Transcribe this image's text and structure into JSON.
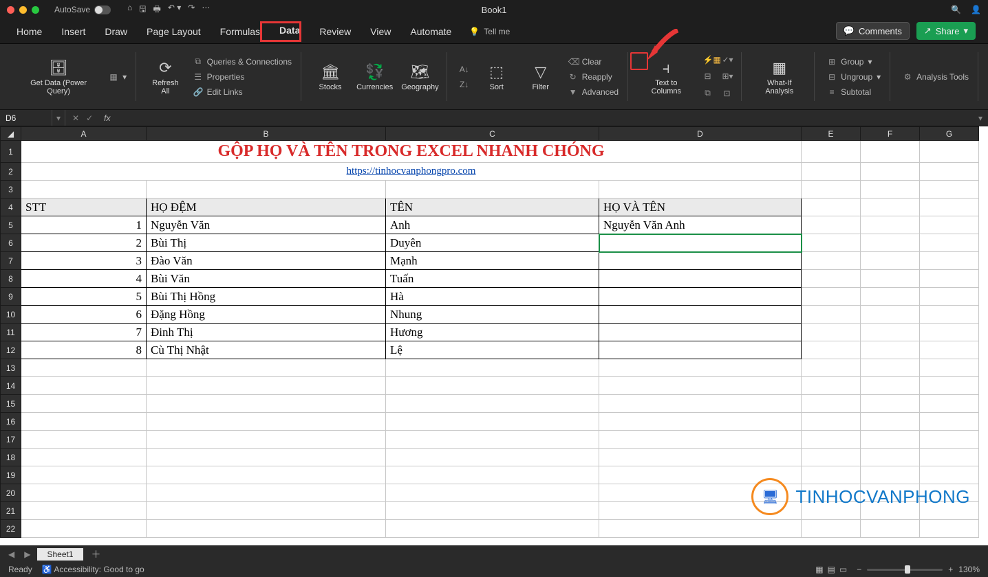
{
  "window_title": "Book1",
  "autosave_label": "AutoSave",
  "tabs": [
    "Home",
    "Insert",
    "Draw",
    "Page Layout",
    "Formulas",
    "Data",
    "Review",
    "View",
    "Automate"
  ],
  "active_tab": "Data",
  "tell_me": "Tell me",
  "comments_btn": "Comments",
  "share_btn": "Share",
  "ribbon": {
    "get_data": "Get Data (Power Query)",
    "refresh": "Refresh All",
    "queries": "Queries & Connections",
    "properties": "Properties",
    "edit_links": "Edit Links",
    "stocks": "Stocks",
    "currencies": "Currencies",
    "geography": "Geography",
    "sort": "Sort",
    "filter": "Filter",
    "clear": "Clear",
    "reapply": "Reapply",
    "advanced": "Advanced",
    "text_cols": "Text to Columns",
    "whatif": "What-If Analysis",
    "group": "Group",
    "ungroup": "Ungroup",
    "subtotal": "Subtotal",
    "analysis": "Analysis Tools"
  },
  "namebox": "D6",
  "formula": "",
  "columns": [
    "A",
    "B",
    "C",
    "D",
    "E",
    "F",
    "G"
  ],
  "title_text": "GỘP HỌ VÀ TÊN TRONG EXCEL NHANH CHÓNG",
  "link_text": "https://tinhocvanphongpro.com",
  "headers": {
    "a": "STT",
    "b": "HỌ ĐỆM",
    "c": "TÊN",
    "d": "HỌ VÀ TÊN"
  },
  "rows": [
    {
      "stt": "1",
      "ho": "Nguyễn Văn",
      "ten": "Anh",
      "full": "Nguyễn Văn Anh"
    },
    {
      "stt": "2",
      "ho": "Bùi Thị",
      "ten": "Duyên",
      "full": ""
    },
    {
      "stt": "3",
      "ho": "Đào Văn",
      "ten": "Mạnh",
      "full": ""
    },
    {
      "stt": "4",
      "ho": "Bùi Văn",
      "ten": "Tuấn",
      "full": ""
    },
    {
      "stt": "5",
      "ho": "Bùi Thị Hồng",
      "ten": "Hà",
      "full": ""
    },
    {
      "stt": "6",
      "ho": "Đặng Hồng",
      "ten": "Nhung",
      "full": ""
    },
    {
      "stt": "7",
      "ho": "Đinh Thị",
      "ten": "Hương",
      "full": ""
    },
    {
      "stt": "8",
      "ho": "Cù Thị Nhật",
      "ten": "Lệ",
      "full": ""
    }
  ],
  "sheet_tab": "Sheet1",
  "status_ready": "Ready",
  "accessibility": "Accessibility: Good to go",
  "zoom": "130%",
  "watermark": "TINHOCVANPHONG"
}
